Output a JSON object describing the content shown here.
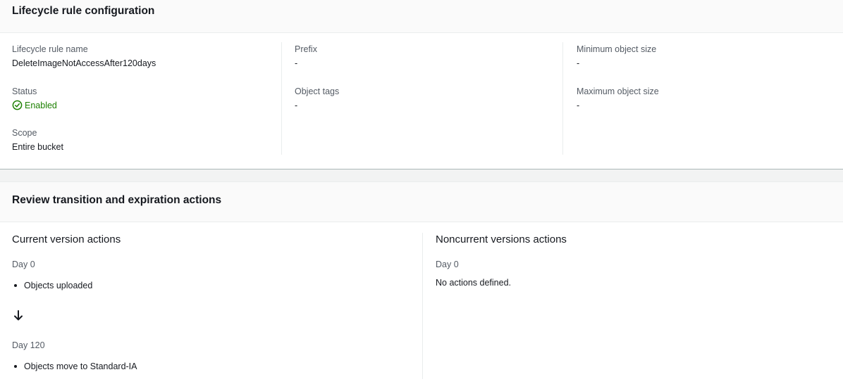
{
  "config": {
    "title": "Lifecycle rule configuration",
    "rule_name_label": "Lifecycle rule name",
    "rule_name_value": "DeleteImageNotAccessAfter120days",
    "status_label": "Status",
    "status_value": "Enabled",
    "scope_label": "Scope",
    "scope_value": "Entire bucket",
    "prefix_label": "Prefix",
    "prefix_value": "-",
    "object_tags_label": "Object tags",
    "object_tags_value": "-",
    "min_size_label": "Minimum object size",
    "min_size_value": "-",
    "max_size_label": "Maximum object size",
    "max_size_value": "-",
    "status_icon": "check-circle-icon",
    "status_color": "#1d8102"
  },
  "review": {
    "title": "Review transition and expiration actions",
    "current": {
      "title": "Current version actions",
      "steps": [
        {
          "day": "Day 0",
          "action": "Objects uploaded"
        },
        {
          "day": "Day 120",
          "action": "Objects move to Standard-IA"
        }
      ],
      "arrow_icon": "arrow-down-icon"
    },
    "noncurrent": {
      "title": "Noncurrent versions actions",
      "day": "Day 0",
      "text": "No actions defined."
    }
  }
}
